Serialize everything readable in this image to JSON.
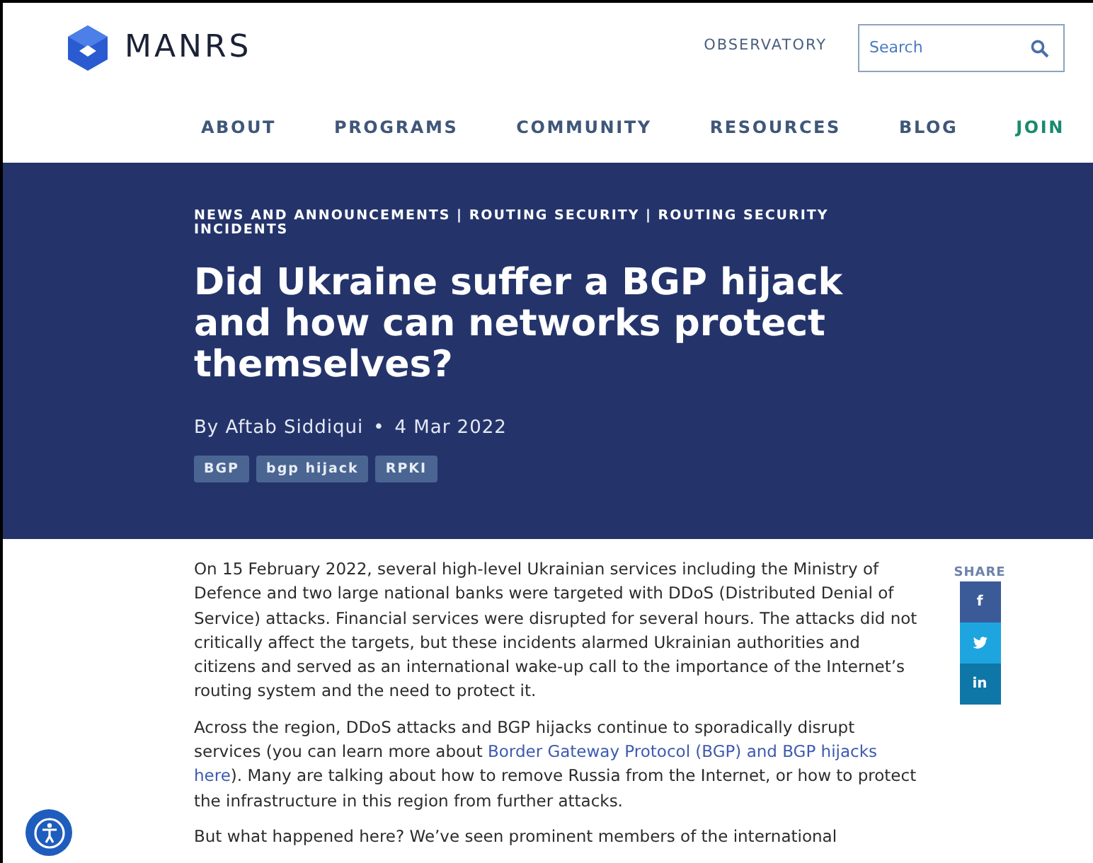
{
  "header": {
    "logo_text": "MANRS",
    "observatory": "OBSERVATORY",
    "search": {
      "placeholder": "Search"
    }
  },
  "nav": [
    {
      "label": "ABOUT",
      "kind": "plain"
    },
    {
      "label": "PROGRAMS",
      "kind": "plain"
    },
    {
      "label": "COMMUNITY",
      "kind": "plain"
    },
    {
      "label": "RESOURCES",
      "kind": "plain"
    },
    {
      "label": "BLOG",
      "kind": "plain"
    },
    {
      "label": "JOIN",
      "kind": "accent"
    }
  ],
  "hero": {
    "categories": "NEWS AND ANNOUNCEMENTS | ROUTING SECURITY | ROUTING SECURITY INCIDENTS",
    "title": "Did Ukraine suffer a BGP hijack and how can networks protect themselves?",
    "author": "By Aftab Siddiqui",
    "separator": "•",
    "date": "4 Mar 2022",
    "tags": [
      "BGP",
      "bgp hijack",
      "RPKI"
    ]
  },
  "article": {
    "paragraphs": [
      [
        {
          "kind": "text",
          "text": "On 15 February 2022, several high-level Ukrainian services including the Ministry of Defence and two large national banks were targeted with DDoS (Distributed Denial of Service) attacks. Financial services were disrupted for several hours. The attacks did not critically affect the targets, but these incidents alarmed Ukrainian authorities and citizens and served as an international wake-up call to the importance of the Internet’s routing system and the need to protect it."
        }
      ],
      [
        {
          "kind": "text",
          "text": "Across the region, DDoS attacks and BGP hijacks continue to sporadically disrupt services (you can learn more about "
        },
        {
          "kind": "link",
          "text": "Border Gateway Protocol (BGP) and BGP hijacks"
        },
        {
          "kind": "link",
          "text": "here"
        },
        {
          "kind": "text",
          "text": "). Many are talking about how to remove Russia from the Internet, or how to protect the infrastructure in this region from further attacks."
        }
      ],
      [
        {
          "kind": "text",
          "text": "But what happened here? We’ve seen prominent members of the international"
        }
      ]
    ]
  },
  "share": {
    "label": "SHARE",
    "buttons": [
      {
        "kind": "facebook",
        "icon": "f"
      },
      {
        "kind": "twitter"
      },
      {
        "kind": "linkedin",
        "icon": "in"
      }
    ]
  }
}
